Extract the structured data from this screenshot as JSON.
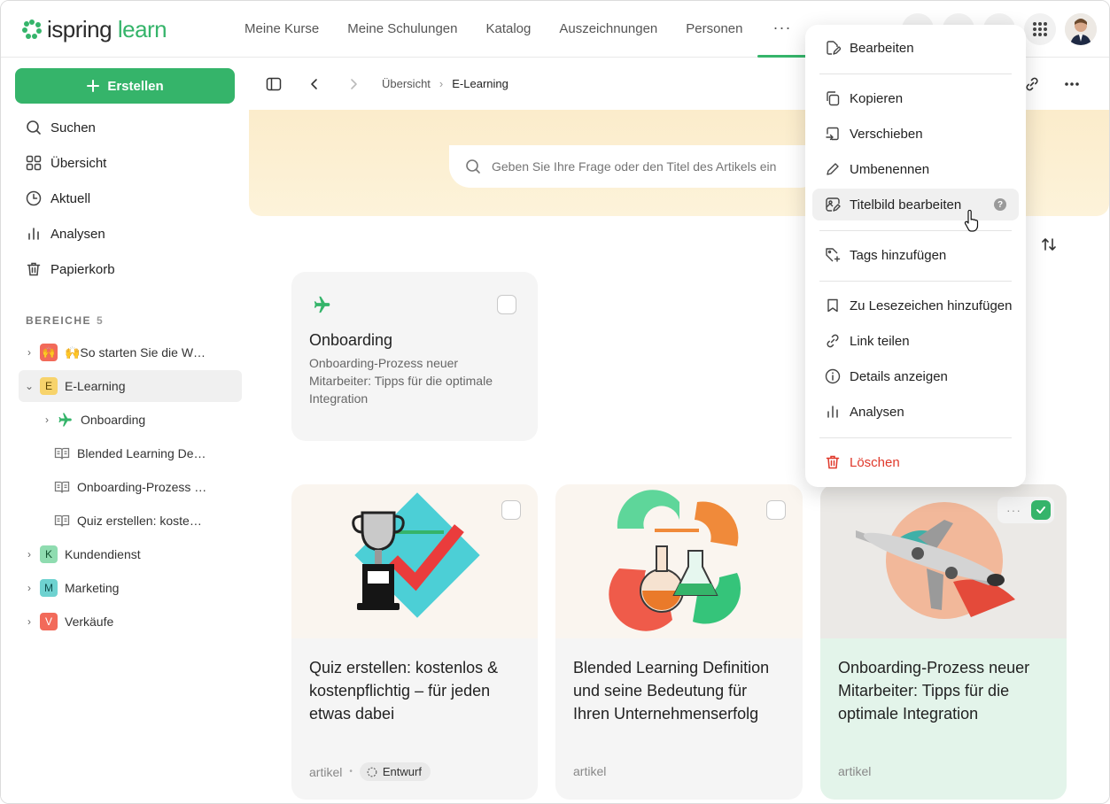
{
  "app": {
    "logo_text_a": "ispring",
    "logo_text_b": "learn"
  },
  "nav": {
    "links": [
      "Meine Kurse",
      "Meine Schulungen",
      "Katalog",
      "Auszeichnungen",
      "Personen"
    ],
    "more": "···"
  },
  "sidebar": {
    "create_label": "Erstellen",
    "menu": [
      "Suchen",
      "Übersicht",
      "Aktuell",
      "Analysen",
      "Papierkorb"
    ],
    "section_title": "BEREICHE",
    "section_count": "5",
    "tree": [
      {
        "badge": "",
        "label": "🙌So starten Sie die W…"
      },
      {
        "badge": "E",
        "label": "E-Learning"
      },
      {
        "label": "Onboarding"
      },
      {
        "label": "Blended Learning De…"
      },
      {
        "label": "Onboarding-Prozess …"
      },
      {
        "label": "Quiz erstellen: koste…"
      },
      {
        "badge": "K",
        "label": "Kundendienst"
      },
      {
        "badge": "M",
        "label": "Marketing"
      },
      {
        "badge": "V",
        "label": "Verkäufe"
      }
    ]
  },
  "breadcrumb": {
    "parent": "Übersicht",
    "current": "E-Learning"
  },
  "search": {
    "placeholder": "Geben Sie Ihre Frage oder den Titel des Artikels ein"
  },
  "cards": {
    "folder": {
      "title": "Onboarding",
      "desc_1": "Onboarding-Prozess neuer",
      "desc_2": "Mitarbeiter: Tipps für die optimale",
      "desc_3": "Integration"
    },
    "quiz": {
      "title_1": "Quiz erstellen: kostenlos &",
      "title_2": "kostenpflichtig – für jeden",
      "title_3": "etwas dabei",
      "type": "artikel",
      "dot": "•",
      "status": "Entwurf"
    },
    "blended": {
      "title_1": "Blended Learning Definition",
      "title_2": "und seine Bedeutung für",
      "title_3": "Ihren Unternehmenserfolg",
      "type": "artikel"
    },
    "onboarding": {
      "title_1": "Onboarding-Prozess neuer",
      "title_2": "Mitarbeiter: Tipps für die",
      "title_3": "optimale Integration",
      "type": "artikel",
      "more": "···"
    }
  },
  "context_menu": {
    "edit": "Bearbeiten",
    "copy": "Kopieren",
    "move": "Verschieben",
    "rename": "Umbenennen",
    "cover": "Titelbild bearbeiten",
    "help": "?",
    "tags": "Tags hinzufügen",
    "bookmark": "Zu Lesezeichen hinzufügen",
    "share": "Link teilen",
    "details": "Details anzeigen",
    "analytics": "Analysen",
    "delete": "Löschen"
  },
  "colors": {
    "brand_green": "#35b46a",
    "danger_red": "#e0392b",
    "badge_e": "#f7d36b",
    "badge_k": "#8fdcb0",
    "badge_m": "#6ed2d0",
    "badge_v": "#f26a5a"
  }
}
